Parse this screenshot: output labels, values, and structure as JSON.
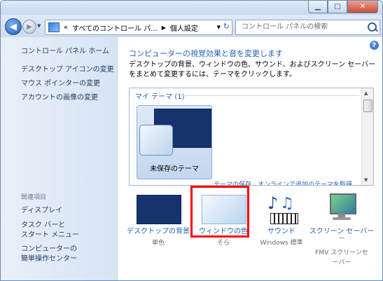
{
  "breadcrumb": {
    "prefix": "«",
    "parent": "すべてのコントロール パ...",
    "current": "個人設定"
  },
  "search": {
    "placeholder": "コントロール パネルの検索"
  },
  "sidebar": {
    "home": "コントロール パネル ホーム",
    "tasks": [
      "デスクトップ アイコンの変更",
      "マウス ポインターの変更",
      "アカウントの画像の変更"
    ],
    "related_heading": "関連項目",
    "related": [
      "ディスプレイ",
      "タスク バーと\nスタート メニュー",
      "コンピューターの\n簡単操作センター"
    ]
  },
  "main": {
    "title": "コンピューターの視覚効果と音を変更します",
    "description": "デスクトップの背景、ウィンドウの色、サウンド、およびスクリーン セーバーをまとめて変更するには、テーマをクリックします。",
    "theme_group": "マイ テーマ (1)",
    "theme_tile_label": "未保存のテーマ",
    "theme_links": "テーマの保存　オンラインで追加のテーマを取得"
  },
  "options": [
    {
      "id": "background",
      "label": "デスクトップの背景",
      "sub": "単色",
      "icon": "desktop-background-icon"
    },
    {
      "id": "window_color",
      "label": "ウィンドウの色",
      "sub": "そら",
      "icon": "window-color-icon",
      "highlighted": true
    },
    {
      "id": "sound",
      "label": "サウンド",
      "sub": "Windows 標準",
      "icon": "sound-icon"
    },
    {
      "id": "screensaver",
      "label": "スクリーン セーバー",
      "label2": "ー",
      "sub": "FMV スクリーンセ",
      "sub2": "ーバー",
      "icon": "screensaver-icon"
    }
  ],
  "colors": {
    "accent": "#1e5fb5",
    "highlight_box": "#ff0000",
    "desktop_swatch": "#17336e",
    "sidebar_bg": "#d7e4f4"
  }
}
